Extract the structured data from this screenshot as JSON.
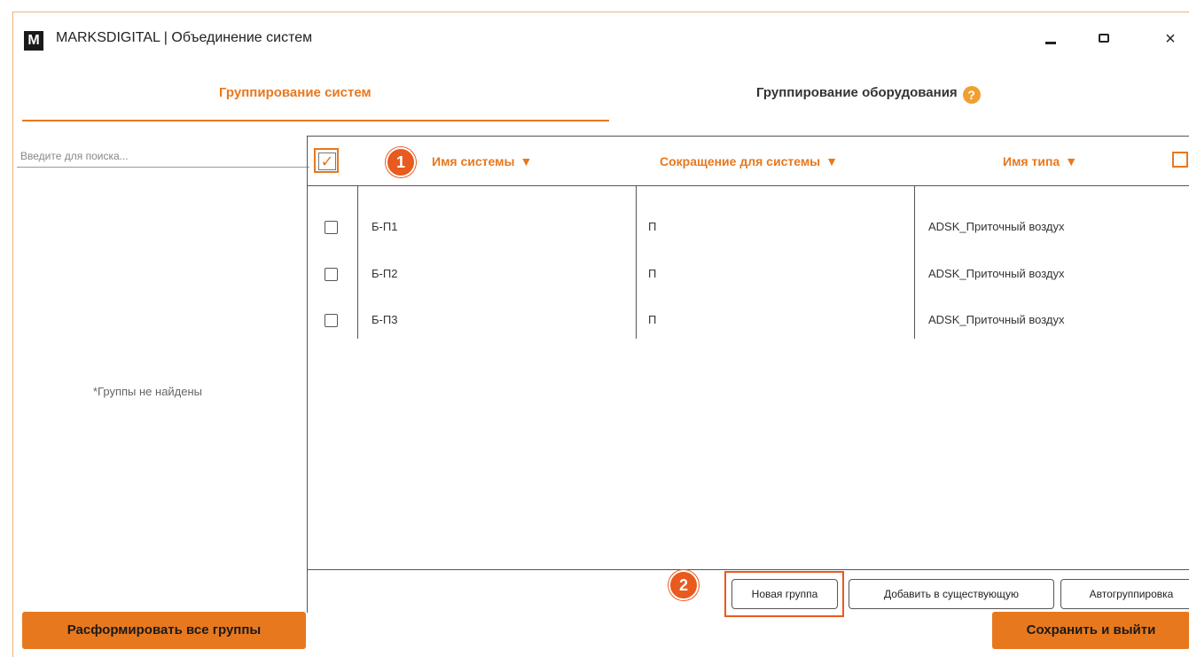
{
  "window": {
    "logo": "M",
    "title": "MARKSDIGITAL | Объединение систем",
    "close_glyph": "×"
  },
  "tabs": {
    "systems": "Группирование систем",
    "equipment": "Группирование оборудования",
    "help_glyph": "?"
  },
  "left_panel": {
    "search_placeholder": "Введите для поиска...",
    "empty_message": "*Группы не найдены",
    "disband_button": "Расформировать все группы"
  },
  "table": {
    "select_all_checked": true,
    "check_glyph": "✓",
    "columns": {
      "name": "Имя системы",
      "abbr": "Сокращение для системы",
      "type": "Имя типа"
    },
    "rows": [
      {
        "name": "Б-П1",
        "abbr": "П",
        "type": "ADSK_Приточный воздух"
      },
      {
        "name": "Б-П2",
        "abbr": "П",
        "type": "ADSK_Приточный воздух"
      },
      {
        "name": "Б-П3",
        "abbr": "П",
        "type": "ADSK_Приточный воздух"
      }
    ],
    "actions": {
      "new_group": "Новая группа",
      "add_existing": "Добавить в существующую",
      "auto_group": "Автогруппировка"
    }
  },
  "callouts": {
    "one": "1",
    "two": "2"
  },
  "save_button": "Сохранить и выйти",
  "colors": {
    "accent": "#e8781e",
    "callout": "#e85a1e"
  },
  "icons": [
    "logo-icon",
    "minimize-icon",
    "restore-icon",
    "close-icon",
    "help-icon",
    "filter-icon",
    "columns-icon",
    "checkbox-icon"
  ]
}
